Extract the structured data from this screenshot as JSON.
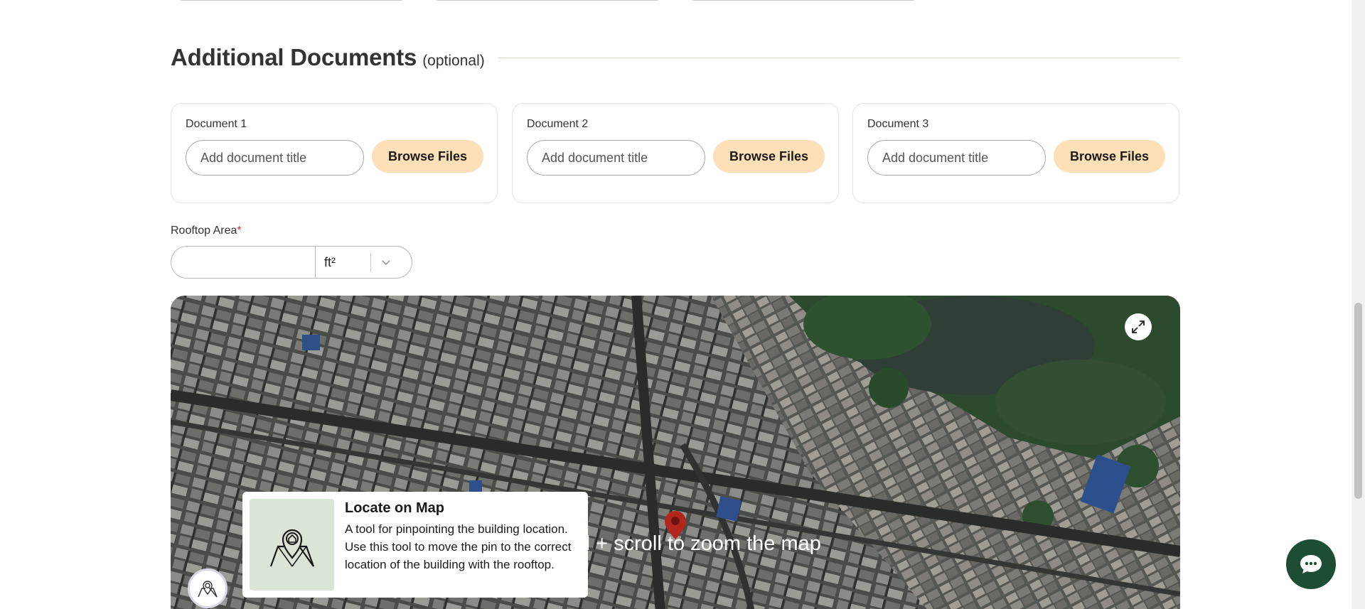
{
  "section": {
    "title": "Additional Documents",
    "optional_note": "(optional)"
  },
  "documents": [
    {
      "label": "Document 1",
      "placeholder": "Add document title",
      "button": "Browse Files"
    },
    {
      "label": "Document 2",
      "placeholder": "Add document title",
      "button": "Browse Files"
    },
    {
      "label": "Document 3",
      "placeholder": "Add document title",
      "button": "Browse Files"
    }
  ],
  "rooftop": {
    "label": "Rooftop Area",
    "required_mark": "*",
    "value": "",
    "unit": "ft²"
  },
  "map": {
    "zoom_hint": "rl + scroll to zoom the map",
    "fullscreen_icon": "expand-icon",
    "pin_icon": "map-pin-icon",
    "locate_icon": "locate-map-icon"
  },
  "tooltip": {
    "title": "Locate on Map",
    "body": "A tool for pinpointing the building location. Use this tool to move the pin to the correct location of the building with the rooftop."
  },
  "chat": {
    "icon": "chat-icon"
  },
  "colors": {
    "accent_button": "#fde0b8",
    "chat_button": "#1e4d35",
    "pin": "#b3261e",
    "tooltip_image_bg": "#dbe5d5",
    "required": "#d33333"
  }
}
